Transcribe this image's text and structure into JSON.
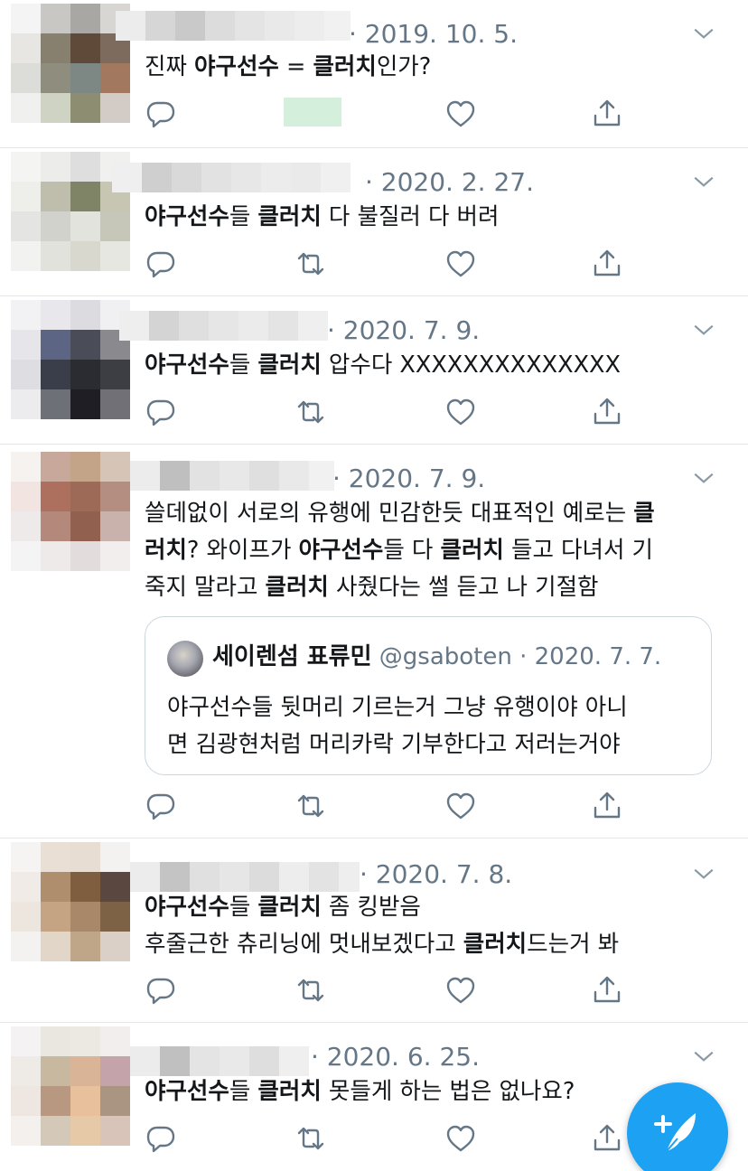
{
  "colors": {
    "accent": "#1da1f2",
    "muted": "#657786",
    "divider": "#e1e8ed",
    "green_block": "#d4f0dc"
  },
  "tweets": [
    {
      "date": "· 2019. 10. 5.",
      "lines": [
        [
          {
            "t": "진짜 ",
            "b": false
          },
          {
            "t": "야구선수",
            "b": true
          },
          {
            "t": " = ",
            "b": false
          },
          {
            "t": "클러치",
            "b": true
          },
          {
            "t": "인가?",
            "b": false
          }
        ]
      ],
      "actions": [
        "reply-icon",
        "like-icon",
        "share-icon"
      ]
    },
    {
      "date": "· 2020. 2. 27.",
      "lines": [
        [
          {
            "t": "야구선수",
            "b": true
          },
          {
            "t": "들 ",
            "b": false
          },
          {
            "t": "클러치",
            "b": true
          },
          {
            "t": " 다 불질러 다 버려",
            "b": false
          }
        ]
      ],
      "actions": [
        "reply-icon",
        "retweet-icon",
        "like-icon",
        "share-icon"
      ]
    },
    {
      "date": "· 2020. 7. 9.",
      "lines": [
        [
          {
            "t": "야구선수",
            "b": true
          },
          {
            "t": "들 ",
            "b": false
          },
          {
            "t": "클러치",
            "b": true
          },
          {
            "t": " 압수다 XXXXXXXXXXXXXX",
            "b": false
          }
        ]
      ],
      "actions": [
        "reply-icon",
        "retweet-icon",
        "like-icon",
        "share-icon"
      ]
    },
    {
      "date": "· 2020. 7. 9.",
      "lines": [
        [
          {
            "t": "쓸데없이 서로의 유행에 민감한듯 대표적인 예로는 ",
            "b": false
          },
          {
            "t": "클",
            "b": true
          }
        ],
        [
          {
            "t": "러치",
            "b": true
          },
          {
            "t": "? 와이프가 ",
            "b": false
          },
          {
            "t": "야구선수",
            "b": true
          },
          {
            "t": "들 다 ",
            "b": false
          },
          {
            "t": "클러치",
            "b": true
          },
          {
            "t": " 들고 다녀서 기",
            "b": false
          }
        ],
        [
          {
            "t": "죽지 말라고 ",
            "b": false
          },
          {
            "t": "클러치",
            "b": true
          },
          {
            "t": " 사줬다는 썰 듣고 나 기절함",
            "b": false
          }
        ]
      ],
      "quote": {
        "name": "세이렌섬 표류민",
        "handle": "@gsaboten",
        "date": "· 2020. 7. 7.",
        "lines": [
          "야구선수들 뒷머리 기르는거 그냥 유행이야 아니",
          "면 김광현처럼 머리카락 기부한다고 저러는거야"
        ]
      },
      "actions": [
        "reply-icon",
        "retweet-icon",
        "like-icon",
        "share-icon"
      ]
    },
    {
      "date": "· 2020. 7. 8.",
      "lines": [
        [
          {
            "t": "야구선수",
            "b": true
          },
          {
            "t": "들 ",
            "b": false
          },
          {
            "t": "클러치",
            "b": true
          },
          {
            "t": " 좀 킹받음",
            "b": false
          }
        ],
        [
          {
            "t": "후줄근한 츄리닝에 멋내보겠다고 ",
            "b": false
          },
          {
            "t": "클러치",
            "b": true
          },
          {
            "t": "드는거 봐",
            "b": false
          }
        ]
      ],
      "actions": [
        "reply-icon",
        "retweet-icon",
        "like-icon",
        "share-icon"
      ]
    },
    {
      "date": "· 2020. 6. 25.",
      "lines": [
        [
          {
            "t": "야구선수",
            "b": true
          },
          {
            "t": "들 ",
            "b": false
          },
          {
            "t": "클러치",
            "b": true
          },
          {
            "t": " 못들게 하는 법은 없나요?",
            "b": false
          }
        ]
      ],
      "actions": [
        "reply-icon",
        "retweet-icon",
        "like-icon",
        "share-icon"
      ]
    }
  ],
  "fab": {
    "icon": "compose-tweet-icon"
  }
}
